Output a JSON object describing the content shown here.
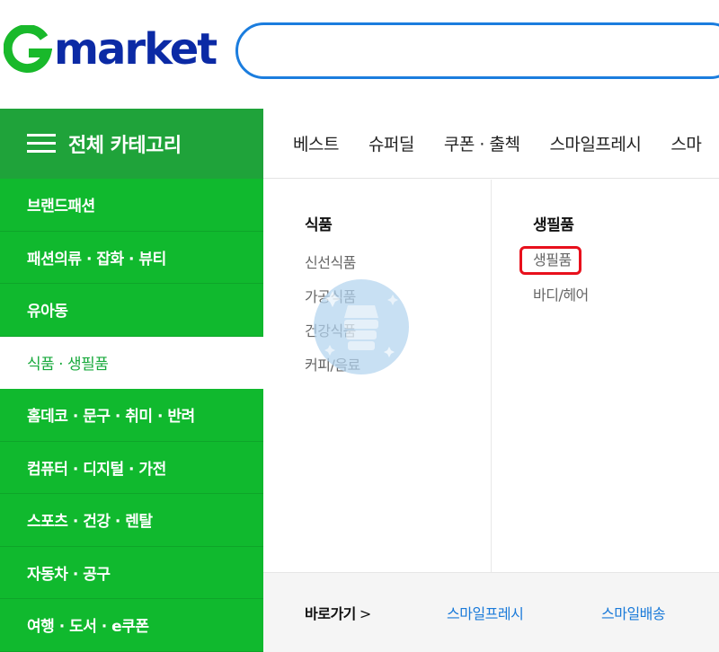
{
  "header": {
    "logo_text": "market",
    "search_placeholder": ""
  },
  "category_button": {
    "label": "전체 카테고리"
  },
  "topnav": {
    "items": [
      "베스트",
      "슈퍼딜",
      "쿠폰 · 출첵",
      "스마일프레시",
      "스마"
    ]
  },
  "sidebar": {
    "items": [
      "브랜드패션",
      "패션의류 · 잡화 · 뷰티",
      "유아동",
      "식품 · 생필품",
      "홈데코 · 문구 · 취미 · 반려",
      "컴퓨터 · 디지털 · 가전",
      "스포츠 · 건강 · 렌탈",
      "자동차 · 공구",
      "여행 · 도서 · e쿠폰"
    ],
    "active_index": 3
  },
  "panel": {
    "col1": {
      "title": "식품",
      "links": [
        "신선식품",
        "가공식품",
        "건강식품",
        "커피/음료"
      ]
    },
    "col2": {
      "title": "생필품",
      "links": [
        "생필품",
        "바디/헤어"
      ],
      "highlighted_index": 0
    }
  },
  "footer": {
    "label": "바로가기",
    "arrow": ">",
    "links": [
      "스마일프레시",
      "스마일배송"
    ]
  },
  "colors": {
    "brand_green": "#10b92e",
    "category_dark_green": "#1fa33a",
    "logo_blue": "#0b2aa5",
    "search_border": "#1b7dde",
    "highlight_red": "#e8101c",
    "link_blue": "#1a7ad9"
  }
}
